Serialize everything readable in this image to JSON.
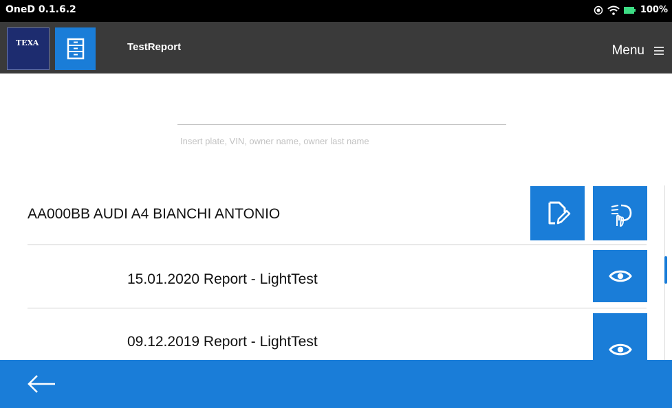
{
  "status_bar": {
    "app_version": "OneD 0.1.6.2",
    "battery": "100%"
  },
  "header": {
    "logo_text": "TEXA",
    "title": "TestReport",
    "menu_label": "Menu"
  },
  "search": {
    "value": "",
    "placeholder": "Insert plate, VIN, owner name, owner last name"
  },
  "vehicle": {
    "label": "AA000BB AUDI A4 BIANCHI ANTONIO"
  },
  "reports": [
    {
      "label": "15.01.2020 Report - LightTest"
    },
    {
      "label": "09.12.2019 Report - LightTest"
    }
  ],
  "icons": {
    "new_report": "document-edit-icon",
    "light_test": "headlight-hand-icon",
    "view": "eye-icon",
    "back": "arrow-left-icon",
    "menu": "hamburger-icon"
  },
  "colors": {
    "accent": "#1a7dd8",
    "header_bg": "#3a3a3a",
    "status_bg": "#000000",
    "logo_bg": "#1d2c6f"
  }
}
